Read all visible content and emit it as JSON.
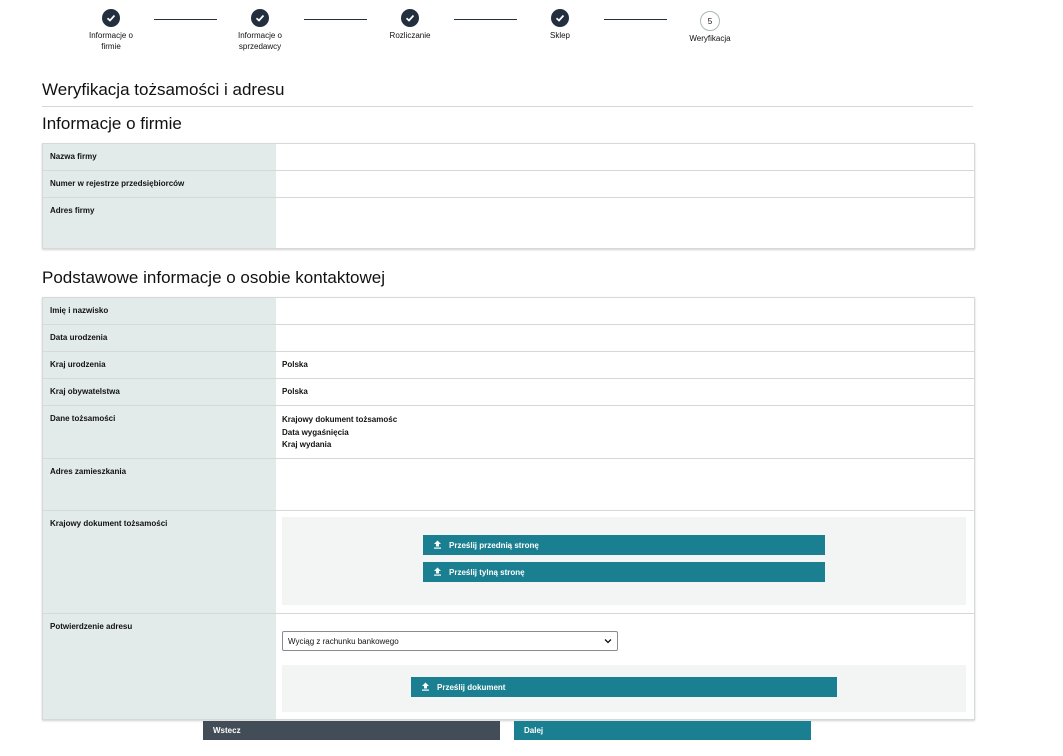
{
  "stepper": {
    "steps": [
      {
        "label": "Informacje o firmie",
        "line1": "Informacje o",
        "line2": "firmie",
        "status": "done"
      },
      {
        "label": "Informacje o sprzedawcy",
        "line1": "Informacje o",
        "line2": "sprzedawcy",
        "status": "done"
      },
      {
        "label": "Rozliczanie",
        "line1": "Rozliczanie",
        "line2": "",
        "status": "done"
      },
      {
        "label": "Sklep",
        "line1": "Sklep",
        "line2": "",
        "status": "done"
      },
      {
        "label": "Weryfikacja",
        "line1": "Weryfikacja",
        "line2": "",
        "status": "current",
        "number": "5"
      }
    ]
  },
  "page_title": "Weryfikacja tożsamości i adresu",
  "company_section": {
    "title": "Informacje o firmie",
    "rows": [
      {
        "label": "Nazwa firmy",
        "value": ""
      },
      {
        "label": "Numer w rejestrze przedsiębiorców",
        "value": ""
      },
      {
        "label": "Adres firmy",
        "value": ""
      }
    ]
  },
  "contact_section": {
    "title": "Podstawowe informacje o osobie kontaktowej",
    "rows": {
      "name": {
        "label": "Imię i nazwisko",
        "value": ""
      },
      "birth_date": {
        "label": "Data urodzenia",
        "value": ""
      },
      "birth_country": {
        "label": "Kraj urodzenia",
        "value": "Polska"
      },
      "citizenship": {
        "label": "Kraj obywatelstwa",
        "value": "Polska"
      },
      "identity": {
        "label": "Dane tożsamości",
        "lines": [
          "Krajowy dokument tożsamośc",
          "Data wygaśnięcia",
          "Kraj wydania"
        ]
      },
      "residence": {
        "label": "Adres zamieszkania",
        "value": ""
      },
      "id_document": {
        "label": "Krajowy dokument tożsamości",
        "upload_front": "Prześlij przednią stronę",
        "upload_back": "Prześlij tylną stronę"
      },
      "address_proof": {
        "label": "Potwierdzenie adresu",
        "selected_option": "Wyciąg z rachunku bankowego",
        "upload_document": "Prześlij dokument"
      }
    }
  },
  "footer": {
    "back_label": "Wstecz",
    "next_label": "Dalej"
  },
  "colors": {
    "accent": "#1a8091",
    "dark": "#232f3e",
    "label_bg": "#e3eaea",
    "back_button": "#424d57"
  }
}
